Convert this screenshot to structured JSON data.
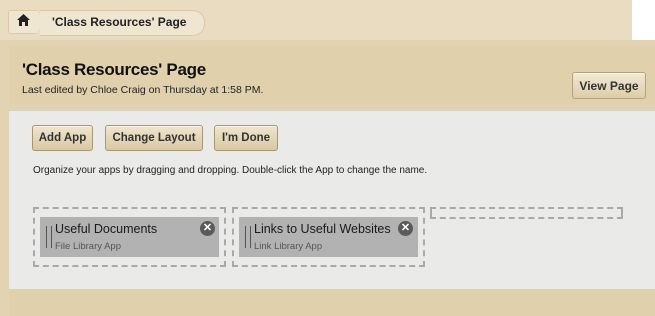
{
  "breadcrumb": {
    "home_icon": "home-icon",
    "current": "'Class Resources' Page"
  },
  "header": {
    "title": "'Class Resources' Page",
    "last_edited": "Last edited by Chloe Craig on Thursday at 1:58 PM.",
    "view_page_label": "View Page"
  },
  "toolbar": {
    "add_app_label": "Add App",
    "change_layout_label": "Change Layout",
    "done_label": "I'm Done"
  },
  "instructions": "Organize your apps by dragging and dropping. Double-click the App to change the name.",
  "apps": [
    {
      "name": "Useful Documents",
      "type": "File Library App",
      "close_icon": "close-icon"
    },
    {
      "name": "Links to Useful Websites",
      "type": "Link Library App",
      "close_icon": "close-icon"
    }
  ],
  "colors": {
    "header_bg": "#e0d1ac",
    "content_bg": "#eaeae8",
    "button_bg": "#d9c8a3",
    "app_bg": "#b2b2b2"
  }
}
